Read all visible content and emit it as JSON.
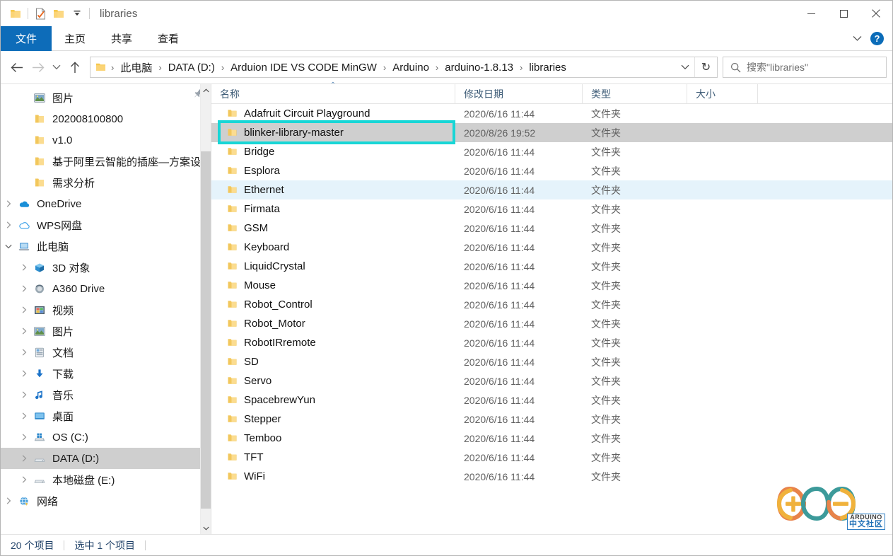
{
  "window": {
    "title": "libraries",
    "quick_access": [
      {
        "name": "folder-icon",
        "label": "folder"
      },
      {
        "name": "properties-icon",
        "label": "properties"
      },
      {
        "name": "new-folder-icon",
        "label": "new folder"
      },
      {
        "name": "customize-qat-icon",
        "label": "customize quick access toolbar"
      }
    ],
    "controls": {
      "minimize": "minimize",
      "maximize": "maximize",
      "close": "close"
    }
  },
  "ribbon": {
    "tabs": [
      {
        "label": "文件",
        "active": true
      },
      {
        "label": "主页",
        "active": false
      },
      {
        "label": "共享",
        "active": false
      },
      {
        "label": "查看",
        "active": false
      }
    ],
    "expand_label": "展开功能区",
    "help_label": "?"
  },
  "address": {
    "back_label": "后退",
    "forward_label": "前进",
    "recent_label": "最近位置",
    "up_label": "上移",
    "breadcrumbs": [
      "此电脑",
      "DATA (D:)",
      "Arduion IDE  VS CODE MinGW",
      "Arduino",
      "arduino-1.8.13",
      "libraries"
    ],
    "separator": "›",
    "dropdown_label": "历史记录",
    "refresh_label": "刷新",
    "refresh_glyph": "↻"
  },
  "search": {
    "placeholder": "搜索\"libraries\"",
    "icon": "search-icon"
  },
  "sidebar": {
    "pin_icon": "pin-icon",
    "items": [
      {
        "label": "图片",
        "indent": 1,
        "chevron": "",
        "icon": "pictures-icon",
        "selected": false,
        "pinned": true
      },
      {
        "label": "202008100800",
        "indent": 1,
        "chevron": "",
        "icon": "folder-icon",
        "selected": false
      },
      {
        "label": "v1.0",
        "indent": 1,
        "chevron": "",
        "icon": "folder-icon",
        "selected": false
      },
      {
        "label": "基于阿里云智能的插座—方案设计",
        "indent": 1,
        "chevron": "",
        "icon": "folder-icon",
        "selected": false
      },
      {
        "label": "需求分析",
        "indent": 1,
        "chevron": "",
        "icon": "folder-icon",
        "selected": false
      },
      {
        "label": "OneDrive",
        "indent": 0,
        "chevron": "›",
        "icon": "onedrive-icon",
        "selected": false
      },
      {
        "label": "WPS网盘",
        "indent": 0,
        "chevron": "›",
        "icon": "wpscloud-icon",
        "selected": false
      },
      {
        "label": "此电脑",
        "indent": 0,
        "chevron": "⌄",
        "icon": "thispc-icon",
        "selected": false
      },
      {
        "label": "3D 对象",
        "indent": 1,
        "chevron": "›",
        "icon": "3dobjects-icon",
        "selected": false
      },
      {
        "label": "A360 Drive",
        "indent": 1,
        "chevron": "›",
        "icon": "a360-icon",
        "selected": false
      },
      {
        "label": "视频",
        "indent": 1,
        "chevron": "›",
        "icon": "videos-icon",
        "selected": false
      },
      {
        "label": "图片",
        "indent": 1,
        "chevron": "›",
        "icon": "pictures-icon",
        "selected": false
      },
      {
        "label": "文档",
        "indent": 1,
        "chevron": "›",
        "icon": "documents-icon",
        "selected": false
      },
      {
        "label": "下载",
        "indent": 1,
        "chevron": "›",
        "icon": "downloads-icon",
        "selected": false
      },
      {
        "label": "音乐",
        "indent": 1,
        "chevron": "›",
        "icon": "music-icon",
        "selected": false
      },
      {
        "label": "桌面",
        "indent": 1,
        "chevron": "›",
        "icon": "desktop-icon",
        "selected": false
      },
      {
        "label": "OS (C:)",
        "indent": 1,
        "chevron": "›",
        "icon": "osdrive-icon",
        "selected": false
      },
      {
        "label": "DATA (D:)",
        "indent": 1,
        "chevron": "›",
        "icon": "drive-icon",
        "selected": true
      },
      {
        "label": "本地磁盘 (E:)",
        "indent": 1,
        "chevron": "›",
        "icon": "drive-icon",
        "selected": false
      },
      {
        "label": "网络",
        "indent": 0,
        "chevron": "›",
        "icon": "network-icon",
        "selected": false
      }
    ]
  },
  "filelist": {
    "columns": [
      {
        "label": "名称",
        "sorted": "asc"
      },
      {
        "label": "修改日期",
        "sorted": ""
      },
      {
        "label": "类型",
        "sorted": ""
      },
      {
        "label": "大小",
        "sorted": ""
      }
    ],
    "sort_caret": "⌃",
    "rows": [
      {
        "name": "Adafruit Circuit Playground",
        "date": "2020/6/16 11:44",
        "type": "文件夹",
        "size": "",
        "state": ""
      },
      {
        "name": "blinker-library-master",
        "date": "2020/8/26 19:52",
        "type": "文件夹",
        "size": "",
        "state": "selected",
        "callout": true
      },
      {
        "name": "Bridge",
        "date": "2020/6/16 11:44",
        "type": "文件夹",
        "size": "",
        "state": ""
      },
      {
        "name": "Esplora",
        "date": "2020/6/16 11:44",
        "type": "文件夹",
        "size": "",
        "state": ""
      },
      {
        "name": "Ethernet",
        "date": "2020/6/16 11:44",
        "type": "文件夹",
        "size": "",
        "state": "hovered"
      },
      {
        "name": "Firmata",
        "date": "2020/6/16 11:44",
        "type": "文件夹",
        "size": "",
        "state": ""
      },
      {
        "name": "GSM",
        "date": "2020/6/16 11:44",
        "type": "文件夹",
        "size": "",
        "state": ""
      },
      {
        "name": "Keyboard",
        "date": "2020/6/16 11:44",
        "type": "文件夹",
        "size": "",
        "state": ""
      },
      {
        "name": "LiquidCrystal",
        "date": "2020/6/16 11:44",
        "type": "文件夹",
        "size": "",
        "state": ""
      },
      {
        "name": "Mouse",
        "date": "2020/6/16 11:44",
        "type": "文件夹",
        "size": "",
        "state": ""
      },
      {
        "name": "Robot_Control",
        "date": "2020/6/16 11:44",
        "type": "文件夹",
        "size": "",
        "state": ""
      },
      {
        "name": "Robot_Motor",
        "date": "2020/6/16 11:44",
        "type": "文件夹",
        "size": "",
        "state": ""
      },
      {
        "name": "RobotIRremote",
        "date": "2020/6/16 11:44",
        "type": "文件夹",
        "size": "",
        "state": ""
      },
      {
        "name": "SD",
        "date": "2020/6/16 11:44",
        "type": "文件夹",
        "size": "",
        "state": ""
      },
      {
        "name": "Servo",
        "date": "2020/6/16 11:44",
        "type": "文件夹",
        "size": "",
        "state": ""
      },
      {
        "name": "SpacebrewYun",
        "date": "2020/6/16 11:44",
        "type": "文件夹",
        "size": "",
        "state": ""
      },
      {
        "name": "Stepper",
        "date": "2020/6/16 11:44",
        "type": "文件夹",
        "size": "",
        "state": ""
      },
      {
        "name": "Temboo",
        "date": "2020/6/16 11:44",
        "type": "文件夹",
        "size": "",
        "state": ""
      },
      {
        "name": "TFT",
        "date": "2020/6/16 11:44",
        "type": "文件夹",
        "size": "",
        "state": ""
      },
      {
        "name": "WiFi",
        "date": "2020/6/16 11:44",
        "type": "文件夹",
        "size": "",
        "state": ""
      }
    ]
  },
  "watermark": {
    "line1": "ARDUINO",
    "line2": "中文社区"
  },
  "statusbar": {
    "count_text": "20 个项目",
    "selection_text": "选中 1 个项目"
  },
  "colors": {
    "accent_blue": "#0d6cb9",
    "callout_cyan": "#18d6d6",
    "selected_gray": "#cfcfcf",
    "hover_blue": "#e5f3fb",
    "folder_yellow": "#f7d478"
  }
}
